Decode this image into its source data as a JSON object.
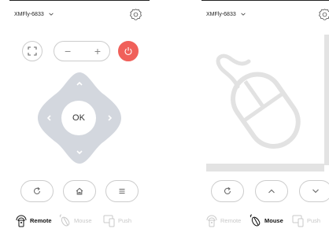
{
  "left": {
    "header": {
      "device_name": "XMFly-6833",
      "icons": [
        "chevron-down-icon",
        "gear-icon"
      ]
    },
    "toolbar": {
      "fullscreen_icon": "expand-icon",
      "volume_minus": "−",
      "volume_plus": "+",
      "power_icon": "power-icon",
      "power_color": "#f0605a"
    },
    "dpad": {
      "ok_label": "OK",
      "color": "#d3d7de"
    },
    "bottom_buttons": [
      "refresh-icon",
      "home-icon",
      "menu-icon"
    ],
    "tabs": [
      {
        "label": "Remote",
        "icon": "remote-icon",
        "active": true
      },
      {
        "label": "Mouse",
        "icon": "mouse-icon",
        "active": false
      },
      {
        "label": "Push",
        "icon": "push-icon",
        "active": false
      }
    ]
  },
  "right": {
    "header": {
      "device_name": "XMFly-6833",
      "icons": [
        "chevron-down-icon",
        "gear-icon"
      ]
    },
    "touchpad": {
      "icon": "mouse-icon"
    },
    "bottom_buttons": [
      "refresh-icon",
      "chevron-up-icon",
      "chevron-down-icon"
    ],
    "tabs": [
      {
        "label": "Remote",
        "icon": "remote-icon",
        "active": false
      },
      {
        "label": "Mouse",
        "icon": "mouse-icon",
        "active": true
      },
      {
        "label": "Push",
        "icon": "push-icon",
        "active": false
      }
    ]
  }
}
